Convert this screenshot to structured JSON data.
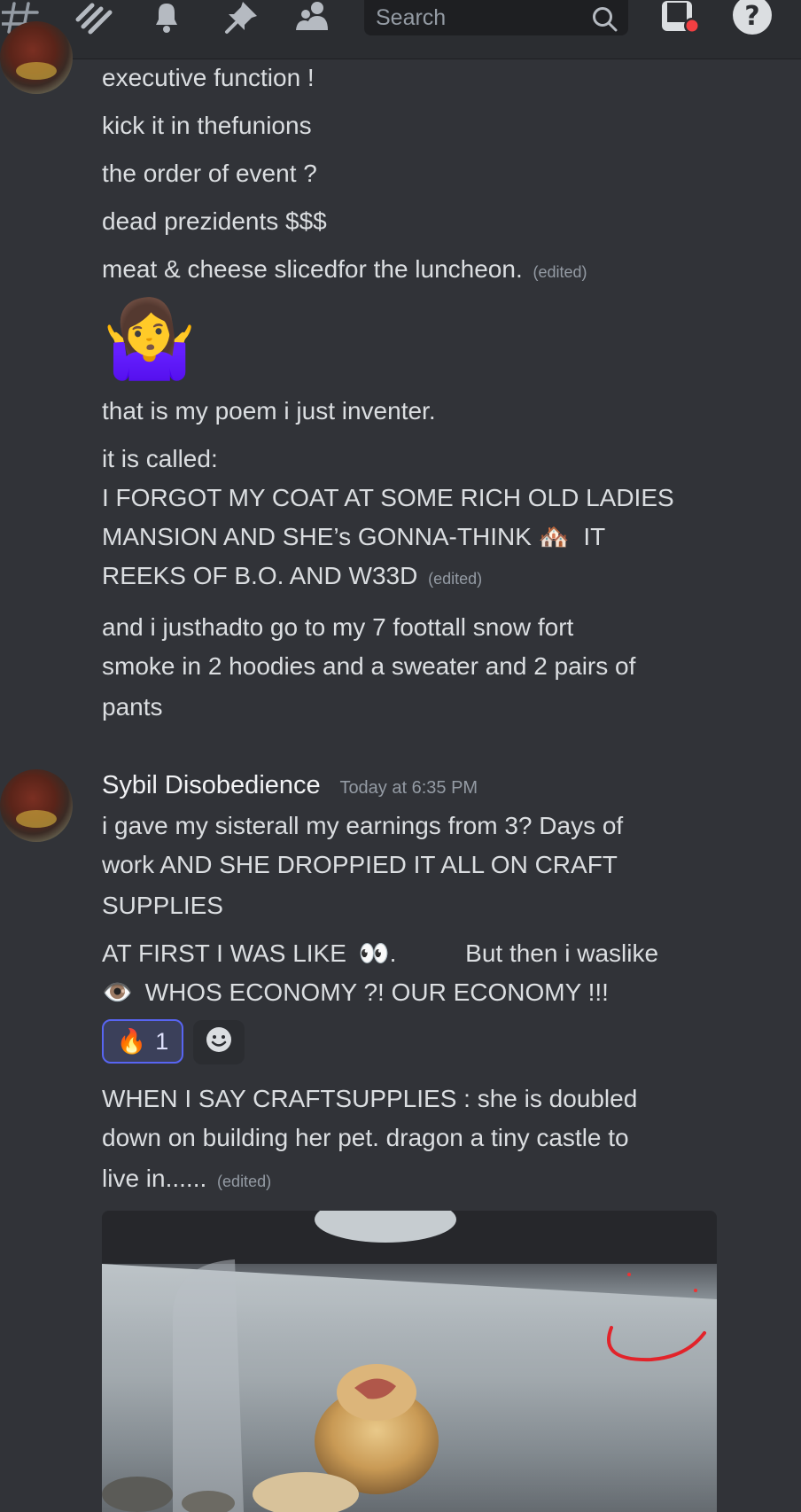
{
  "topbar": {
    "search_placeholder": "Search",
    "icons": [
      "hashtag-icon",
      "threads-icon",
      "bell-icon",
      "pin-icon",
      "members-icon",
      "search-icon",
      "inbox-icon",
      "help-icon"
    ]
  },
  "messages": {
    "continued_lines": [
      "executive function !",
      "kick it in thefunions",
      "the order of event ?",
      "dead prezidents $$$",
      "meat & cheese slicedfor the luncheon."
    ],
    "edited_label": "(edited)",
    "shrug_emoji": "🤷‍♀️",
    "poem_intro": "that is my poem i just inventer.",
    "title_lines": [
      "it is called:",
      "I FORGOT MY COAT AT SOME RICH OLD LADIES",
      "MANSION AND SHE’s GONNA-THINK",
      "IT",
      "REEKS OF B.O. AND W33D"
    ],
    "house_emoji": "🏘️",
    "fort_lines": [
      "and i justhadto  go to my 7 foottall snow fort",
      "smoke in 2 hoodies and a sweater and 2 pairs of",
      "pants"
    ],
    "author": "Sybil Disobedience",
    "timestamp": "Today at 6:35 PM",
    "earnings_lines": [
      "i gave my sisterall my earnings from 3? Days of",
      "work AND SHE DROPPIED IT ALL ON CRAFT",
      "SUPPLIES"
    ],
    "first_line_a": "AT FIRST I WAS LIKE",
    "eyes_emoji": "👀",
    "first_line_b": ".",
    "first_line_c": "But then i waslike",
    "eye_emoji": "👁️",
    "economy_text": "WHOS ECONOMY ?! OUR ECONOMY !!!",
    "reaction": {
      "emoji": "🔥",
      "count": "1"
    },
    "craft_lines": [
      "WHEN I SAY CRAFTSUPPLIES : she is doubled",
      "down on building her pet. dragon a tiny castle to",
      "live in......"
    ]
  },
  "colors": {
    "background": "#313338",
    "topbar": "#2b2d31",
    "text": "#dbdee1",
    "muted": "#949ba4",
    "accent": "#5865f2",
    "notification": "#f23f42"
  }
}
